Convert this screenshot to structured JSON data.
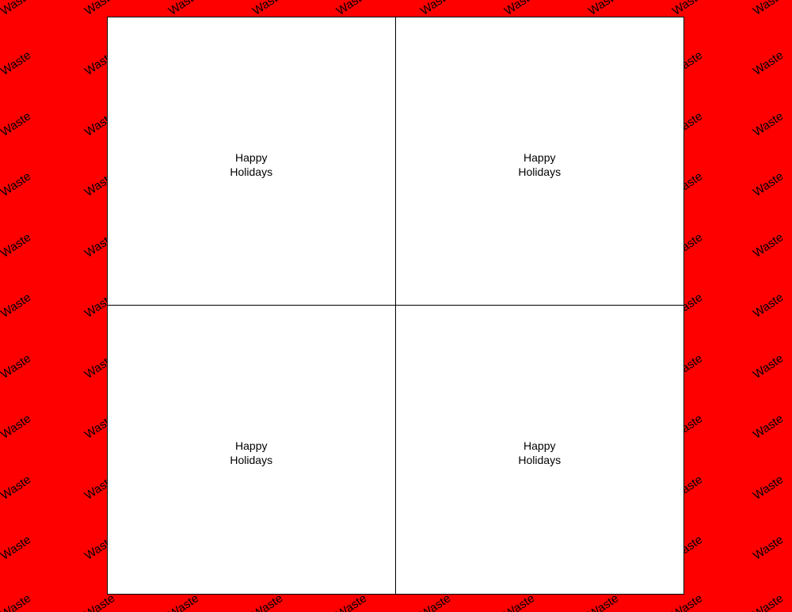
{
  "background": {
    "color": "#ff0000",
    "watermark_text": "Waste"
  },
  "sheet": {
    "color": "#ffffff",
    "border_color": "#000000"
  },
  "cards": [
    {
      "line1": "Happy",
      "line2": "Holidays"
    },
    {
      "line1": "Happy",
      "line2": "Holidays"
    },
    {
      "line1": "Happy",
      "line2": "Holidays"
    },
    {
      "line1": "Happy",
      "line2": "Holidays"
    }
  ]
}
